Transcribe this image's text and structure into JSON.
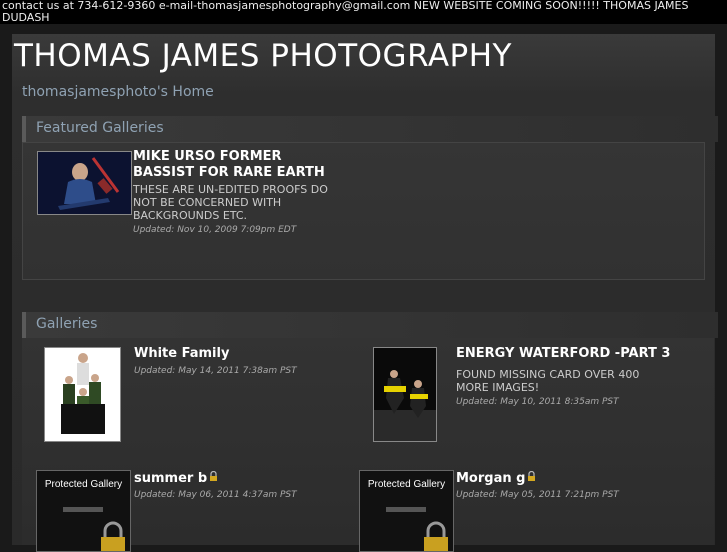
{
  "topbar": {
    "text": "contact us at 734-612-9360 e-mail-thomasjamesphotography@gmail.com NEW WEBSITE COMING SOON!!!!! THOMAS JAMES DUDASH"
  },
  "site": {
    "title": "THOMAS JAMES PHOTOGRAPHY",
    "home_link": "thomasjamesphoto's Home"
  },
  "featured": {
    "header": "Featured Galleries",
    "items": [
      {
        "title": "MIKE URSO FORMER BASSIST FOR RARE EARTH",
        "description": "THESE ARE UN-EDITED PROOFS DO NOT BE CONCERNED WITH BACKGROUNDS ETC.",
        "updated": "Updated: Nov 10, 2009 7:09pm EDT"
      }
    ]
  },
  "galleries": {
    "header": "Galleries",
    "items": [
      {
        "title": "White Family",
        "description": "",
        "updated": "Updated: May 14, 2011 7:38am PST",
        "icon": "family-photo"
      },
      {
        "title": "ENERGY WATERFORD -PART 3",
        "description": "FOUND MISSING CARD OVER 400 MORE IMAGES!",
        "updated": "Updated: May 10, 2011 8:35am PST",
        "icon": "dance-photo"
      },
      {
        "title": "summer b",
        "description": "",
        "updated": "Updated: May 06, 2011 4:37am PST",
        "protected_text": "Protected Gallery",
        "icon": "lock-icon"
      },
      {
        "title": "Morgan g",
        "description": "",
        "updated": "Updated: May 05, 2011 7:21pm PST",
        "protected_text": "Protected Gallery",
        "icon": "lock-icon"
      }
    ]
  },
  "colors": {
    "link": "#8fa2b3",
    "background": "#2e2e2e",
    "topbar": "#000000"
  }
}
